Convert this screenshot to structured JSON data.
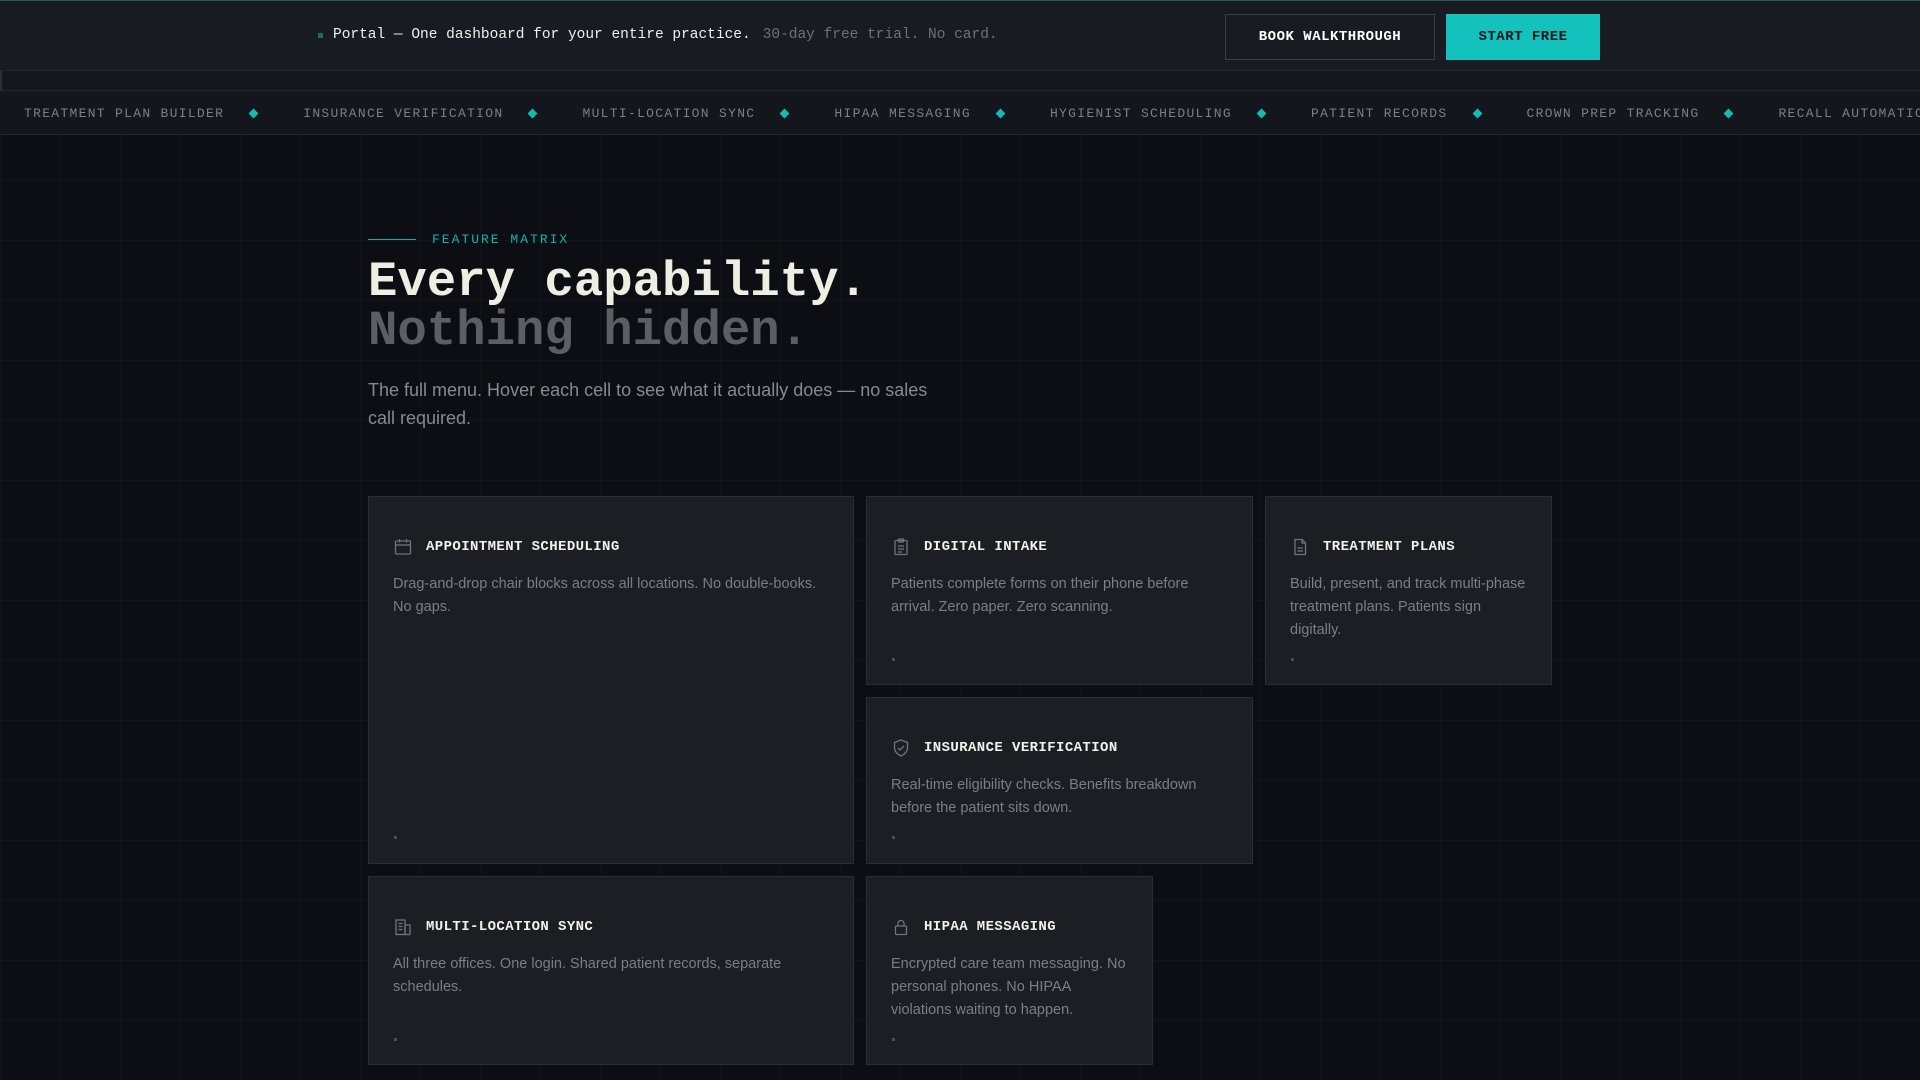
{
  "topbar": {
    "announcement_strong": "Portal — One dashboard for your entire practice.",
    "announcement_muted": "30-day free trial. No card.",
    "walkthrough_button": "BOOK WALKTHROUGH",
    "start_button": "START FREE",
    "accent_color": "#13c2bd"
  },
  "ticker": {
    "items": [
      "TREATMENT PLAN BUILDER",
      "INSURANCE VERIFICATION",
      "MULTI-LOCATION SYNC",
      "HIPAA MESSAGING",
      "HYGIENIST SCHEDULING",
      "PATIENT RECORDS",
      "CROWN PREP TRACKING",
      "RECALL AUTOMATION"
    ]
  },
  "hero": {
    "eyebrow": "FEATURE MATRIX",
    "title_line1": "Every capability.",
    "title_line2": "Nothing hidden.",
    "lede": "The full menu. Hover each cell to see what it actually does — no sales call required."
  },
  "cards": [
    {
      "icon": "calendar-icon",
      "title": "APPOINTMENT SCHEDULING",
      "desc": "Drag-and-drop chair blocks across all locations. No double-books. No gaps."
    },
    {
      "icon": "clipboard-icon",
      "title": "DIGITAL INTAKE",
      "desc": "Patients complete forms on their phone before arrival. Zero paper. Zero scanning."
    },
    {
      "icon": "document-icon",
      "title": "TREATMENT PLANS",
      "desc": "Build, present, and track multi-phase treatment plans. Patients sign digitally."
    },
    {
      "icon": "shield-check-icon",
      "title": "INSURANCE VERIFICATION",
      "desc": "Real-time eligibility checks. Benefits breakdown before the patient sits down."
    },
    {
      "icon": "building-icon",
      "title": "MULTI-LOCATION SYNC",
      "desc": "All three offices. One login. Shared patient records, separate schedules."
    },
    {
      "icon": "lock-icon",
      "title": "HIPAA MESSAGING",
      "desc": "Encrypted care team messaging. No personal phones. No HIPAA violations waiting to happen."
    }
  ]
}
